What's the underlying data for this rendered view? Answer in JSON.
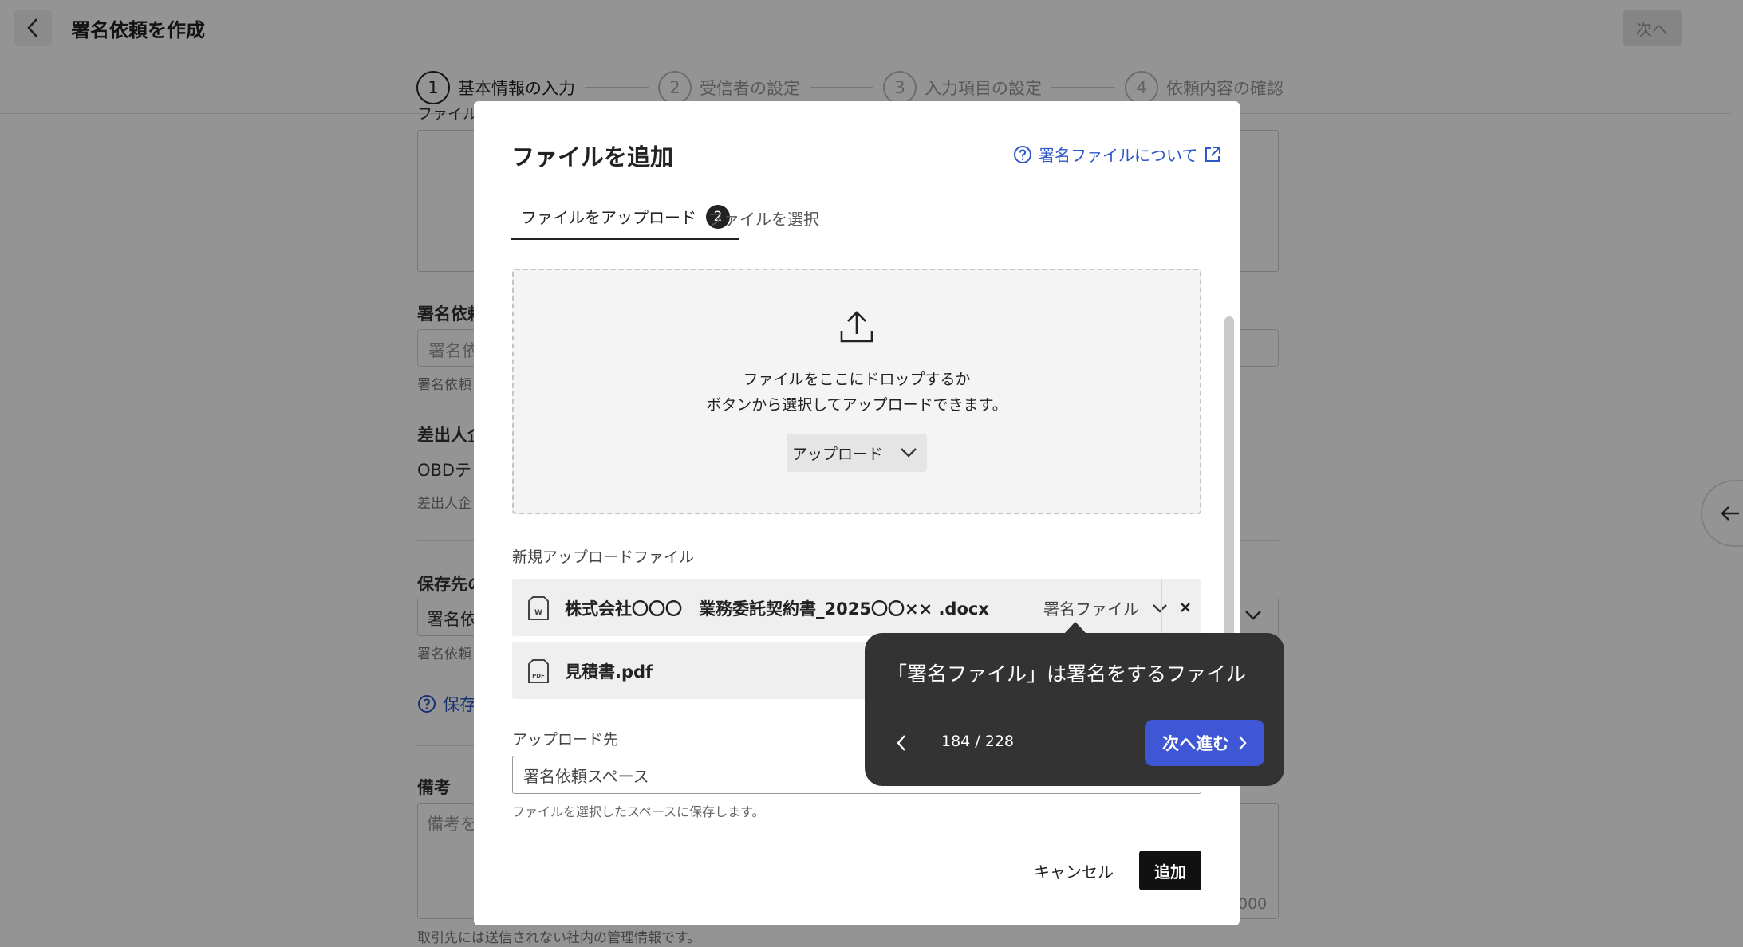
{
  "header": {
    "title": "署名依頼を作成",
    "next_label": "次へ"
  },
  "stepper": {
    "steps": [
      {
        "num": "1",
        "label": "基本情報の入力"
      },
      {
        "num": "2",
        "label": "受信者の設定"
      },
      {
        "num": "3",
        "label": "入力項目の設定"
      },
      {
        "num": "4",
        "label": "依頼内容の確認"
      }
    ]
  },
  "background_form": {
    "file_label": "ファイル",
    "request_name_label": "署名依頼",
    "request_name_placeholder": "署名依",
    "request_name_help": "署名依頼",
    "sender_label": "差出人企",
    "sender_value": "OBDテ",
    "sender_help": "差出人企",
    "save_label": "保存先の",
    "save_value": "署名依",
    "save_help": "署名依頼",
    "save_link": "保存",
    "notes_label": "備考",
    "notes_placeholder": "備考を",
    "notes_counter": "000",
    "notes_help": "取引先には送信されない社内の管理情報です。"
  },
  "modal": {
    "title": "ファイルを追加",
    "help_link": "署名ファイルについて",
    "tabs": [
      {
        "label": "ファイルをアップロード",
        "badge": "2"
      },
      {
        "label": "ファイルを選択"
      }
    ],
    "dropzone": {
      "line1": "ファイルをここにドロップするか",
      "line2": "ボタンから選択してアップロードできます。",
      "upload_label": "アップロード"
    },
    "new_files_label": "新規アップロードファイル",
    "files": [
      {
        "name": "株式会社〇〇〇　業務委託契約書_2025〇〇×× .docx",
        "type": "署名ファイル",
        "icon": "word-file-icon"
      },
      {
        "name": "見積書.pdf",
        "icon": "pdf-file-icon"
      }
    ],
    "destination_label": "アップロード先",
    "destination_value": "署名依頼スペース",
    "destination_help": "ファイルを選択したスペースに保存します。",
    "cancel_label": "キャンセル",
    "add_label": "追加"
  },
  "coach_mark": {
    "text": "「署名ファイル」は署名をするファイル",
    "counter": "184 / 228",
    "next_label": "次へ進む"
  },
  "colors": {
    "accent": "#2d57c8",
    "coach_button": "#3f57d4",
    "coach_bg": "#333333"
  }
}
